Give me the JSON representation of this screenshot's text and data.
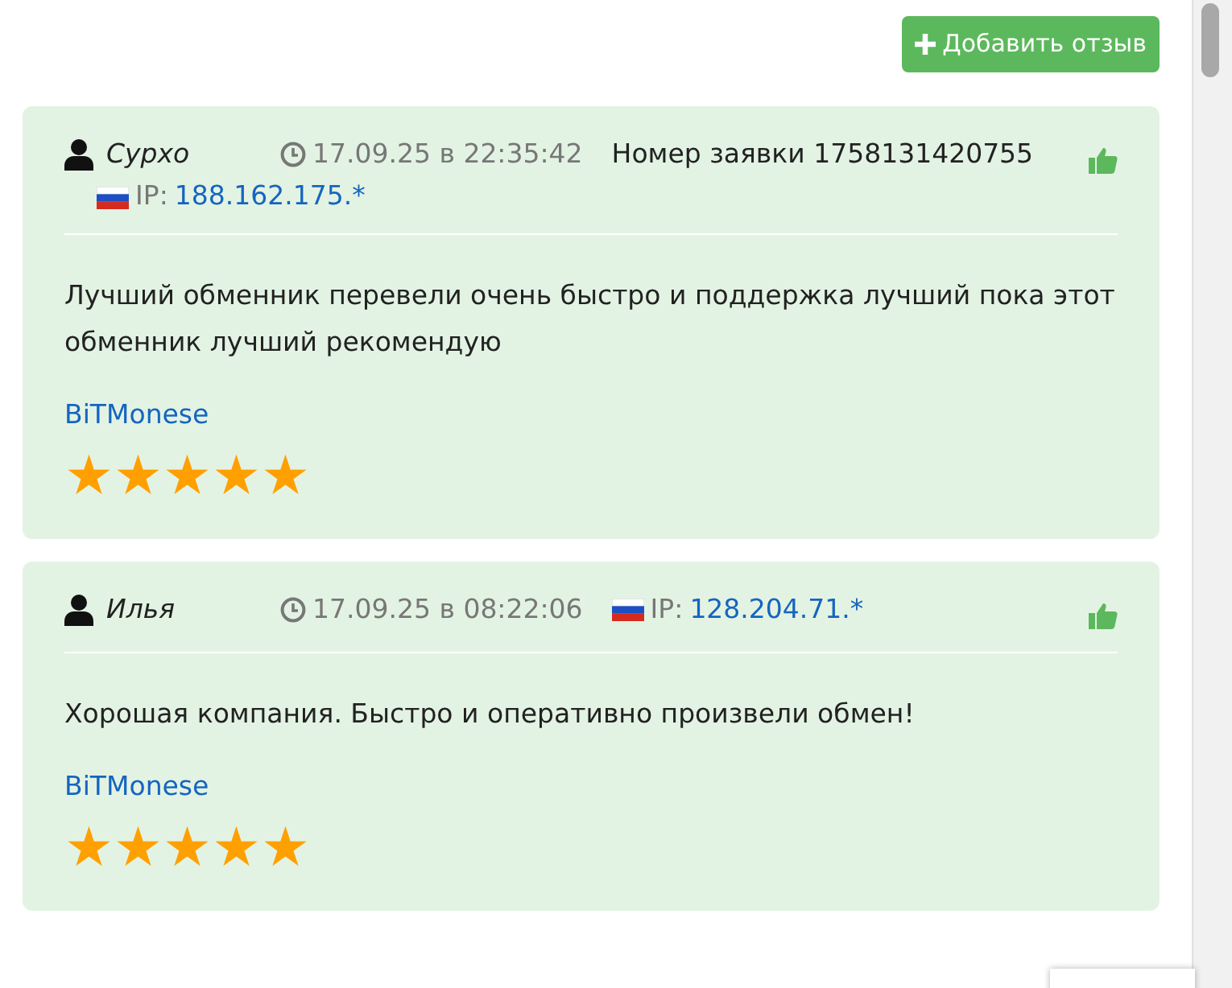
{
  "add_button": {
    "label": "Добавить отзыв"
  },
  "reviews": [
    {
      "author": "Сурхо",
      "datetime": "17.09.25 в 22:35:42",
      "order": "Номер заявки 1758131420755",
      "ip_label": "IP:",
      "ip": "188.162.175.*",
      "text": "Лучший обменник перевели очень быстро и поддержка лучший пока этот обменник лучший рекомендую",
      "exchanger": "BiTMonese",
      "stars": 5
    },
    {
      "author": "Илья",
      "datetime": "17.09.25 в 08:22:06",
      "ip_label": "IP:",
      "ip": "128.204.71.*",
      "text": "Хорошая компания. Быстро и оперативно произвели обмен!",
      "exchanger": "BiTMonese",
      "stars": 5
    }
  ]
}
